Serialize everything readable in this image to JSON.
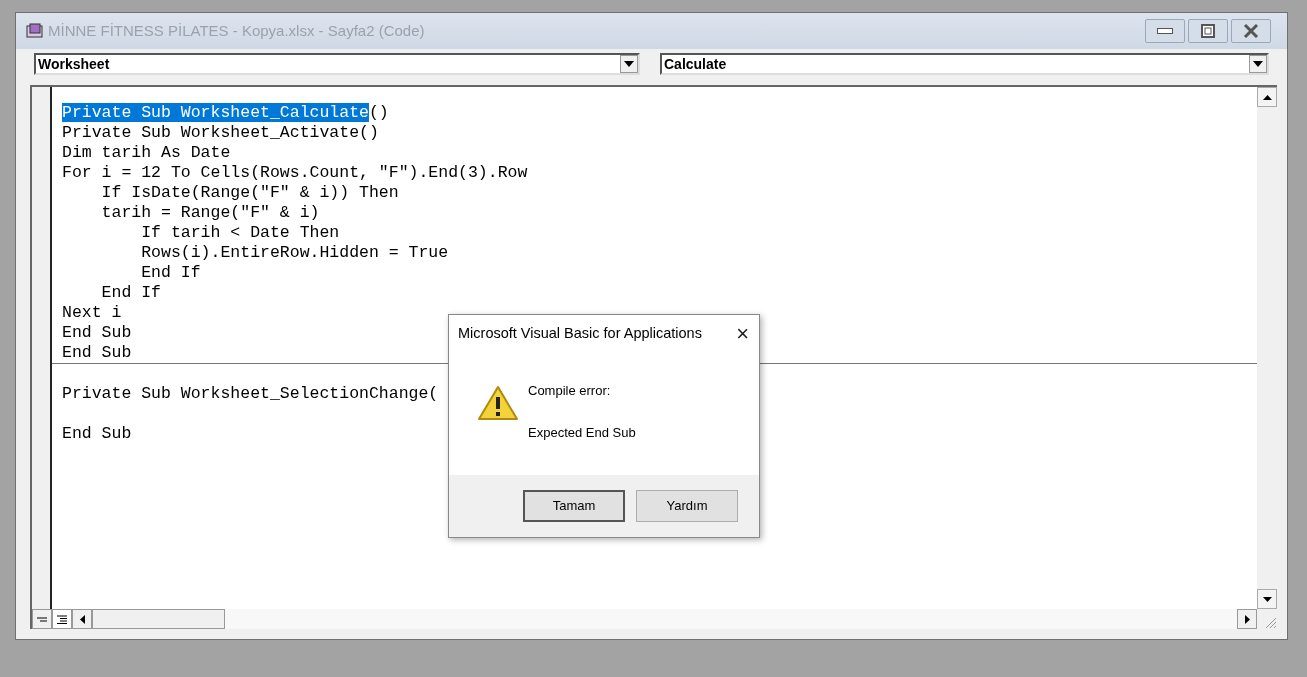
{
  "window": {
    "title": "MİNNE FİTNESS PİLATES - Kopya.xlsx - Sayfa2 (Code)"
  },
  "object_dropdown": {
    "value": "Worksheet"
  },
  "procedure_dropdown": {
    "value": "Calculate"
  },
  "code_procedures": [
    {
      "lines": [
        {
          "segments": [
            {
              "text": "Private Sub Worksheet_Calculate",
              "selected": true
            },
            {
              "text": "()",
              "selected": false
            }
          ]
        },
        {
          "segments": [
            {
              "text": "Private Sub Worksheet_Activate()",
              "selected": false
            }
          ]
        },
        {
          "segments": [
            {
              "text": "Dim tarih As Date",
              "selected": false
            }
          ]
        },
        {
          "segments": [
            {
              "text": "For i = 12 To Cells(Rows.Count, \"F\").End(3).Row",
              "selected": false
            }
          ]
        },
        {
          "segments": [
            {
              "text": "    If IsDate(Range(\"F\" & i)) Then",
              "selected": false
            }
          ]
        },
        {
          "segments": [
            {
              "text": "    tarih = Range(\"F\" & i)",
              "selected": false
            }
          ]
        },
        {
          "segments": [
            {
              "text": "        If tarih < Date Then",
              "selected": false
            }
          ]
        },
        {
          "segments": [
            {
              "text": "        Rows(i).EntireRow.Hidden = True",
              "selected": false
            }
          ]
        },
        {
          "segments": [
            {
              "text": "        End If",
              "selected": false
            }
          ]
        },
        {
          "segments": [
            {
              "text": "    End If",
              "selected": false
            }
          ]
        },
        {
          "segments": [
            {
              "text": "Next i",
              "selected": false
            }
          ]
        },
        {
          "segments": [
            {
              "text": "End Sub",
              "selected": false
            }
          ]
        },
        {
          "segments": [
            {
              "text": "End Sub",
              "selected": false
            }
          ]
        }
      ]
    },
    {
      "lines": [
        {
          "segments": [
            {
              "text": "Private Sub Worksheet_SelectionChange(",
              "selected": false
            }
          ]
        },
        {
          "kind": "blank"
        },
        {
          "segments": [
            {
              "text": "End Sub",
              "selected": false
            }
          ]
        }
      ]
    }
  ],
  "dialog": {
    "title": "Microsoft Visual Basic for Applications",
    "close": "×",
    "heading": "Compile error:",
    "message": "Expected End Sub",
    "buttons": [
      {
        "label": "Tamam",
        "selected": true
      },
      {
        "label": "Yardım",
        "selected": false
      }
    ]
  }
}
